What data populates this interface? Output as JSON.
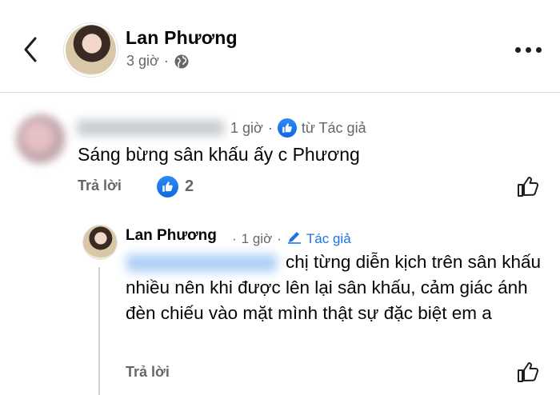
{
  "post": {
    "author_name": "Lan Phương",
    "time": "3 giờ",
    "separator": "·",
    "privacy_icon": "globe-icon"
  },
  "comment": {
    "commenter_name": "Nguyễn Thị Thúy",
    "time": "1 giờ",
    "separator": "·",
    "liked_by_author": "từ Tác giả",
    "text": "Sáng bừng sân khấu ấy c Phương",
    "reply_label": "Trả lời",
    "like_count": "2",
    "reaction_icon": "like-icon"
  },
  "reply": {
    "author_name": "Lan Phương",
    "separator": "·",
    "time": "1 giờ",
    "author_badge": "Tác giả",
    "mention": "Nguyễn Thị Thúy",
    "text": "chị từng diễn kịch trên sân khấu nhiều nên khi được lên lại sân khấu, cảm giác ánh đèn chiếu vào mặt mình thật sự đặc biệt em a",
    "reply_label": "Trả lời"
  },
  "colors": {
    "accent": "#1b74e4",
    "meta": "#65676b",
    "text": "#050505"
  }
}
